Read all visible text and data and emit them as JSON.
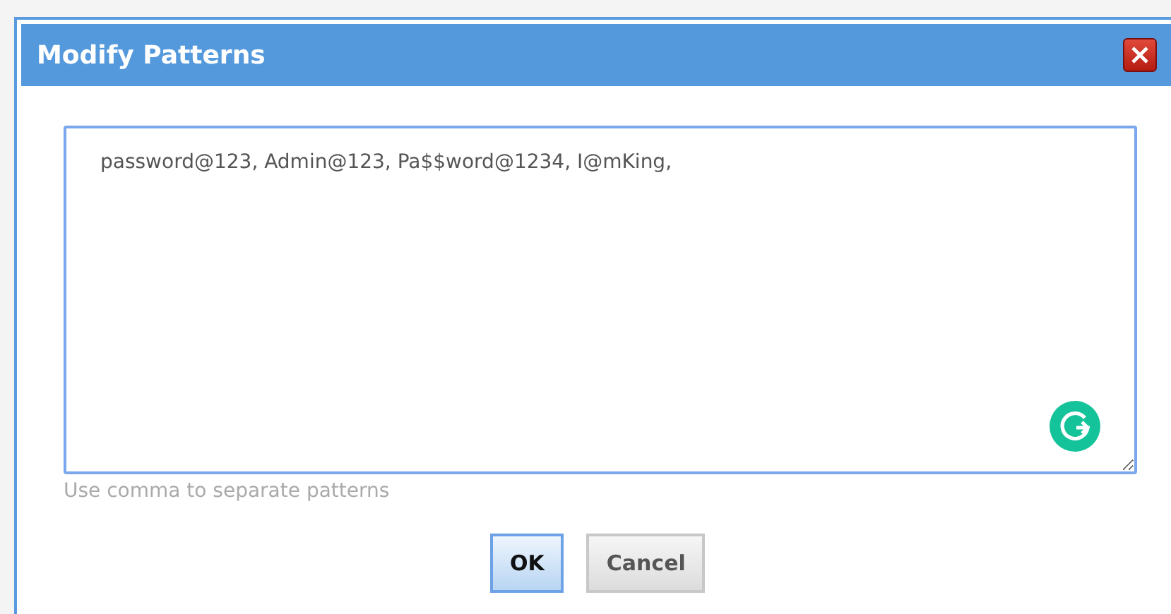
{
  "dialog": {
    "title": "Modify Patterns"
  },
  "patterns_field": {
    "value": "password@123, Admin@123, Pa$$word@1234, I@mKing,",
    "hint": "Use comma to separate patterns"
  },
  "buttons": [
    {
      "label": "OK",
      "kind": "primary"
    },
    {
      "label": "Cancel",
      "kind": "secondary"
    }
  ]
}
